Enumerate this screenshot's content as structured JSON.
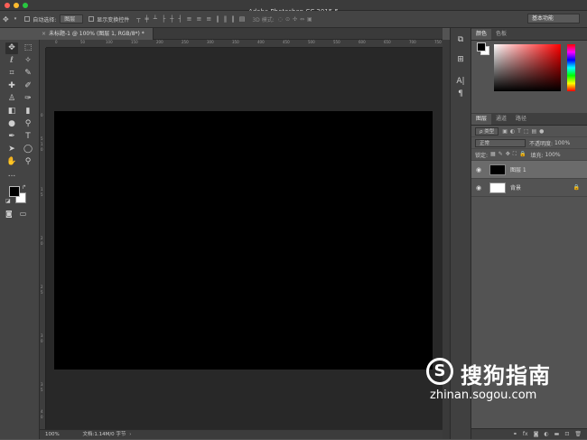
{
  "window": {
    "title": "Adobe Photoshop CC 2015.5"
  },
  "options_bar": {
    "auto_select_label": "自动选择:",
    "auto_select_value": "图层",
    "transform_label": "显示变换控件",
    "mode_3d": "3D 模式:",
    "workspace": "基本功能"
  },
  "tools": {
    "more": "..."
  },
  "document": {
    "tab_title": "未标题-1 @ 100% (图层 1, RGB/8*) *",
    "zoom": "100%",
    "doc_info": "文档:1.14M/0 字节",
    "ruler_h": [
      "0",
      "50",
      "100",
      "150",
      "200",
      "250",
      "300",
      "350",
      "400",
      "450",
      "500",
      "550",
      "600",
      "650",
      "700",
      "750"
    ],
    "ruler_v": [
      "0",
      "5",
      "1",
      "0",
      "1",
      "5",
      "2",
      "0",
      "2",
      "5",
      "3",
      "0",
      "3",
      "5",
      "4",
      "0"
    ]
  },
  "color_panel": {
    "tabs": [
      "颜色",
      "色板"
    ],
    "foreground": "#000000",
    "background": "#ffffff"
  },
  "layers_panel": {
    "tabs": [
      "图层",
      "通道",
      "路径"
    ],
    "filter_type": "ρ 类型",
    "blend_mode": "正常",
    "opacity_label": "不透明度:",
    "opacity_value": "100%",
    "lock_label": "锁定:",
    "fill_label": "填充:",
    "fill_value": "100%",
    "layers": [
      {
        "name": "图层 1",
        "thumb": "#000000"
      },
      {
        "name": "背景",
        "thumb": "#ffffff"
      }
    ],
    "footer_icons": [
      "link-icon",
      "fx-icon",
      "mask-icon",
      "adjustment-icon",
      "folder-icon",
      "new-layer-icon",
      "trash-icon"
    ]
  },
  "watermark": {
    "brand": "搜狗指南",
    "url": "zhinan.sogou.com",
    "logo_char": "S"
  }
}
